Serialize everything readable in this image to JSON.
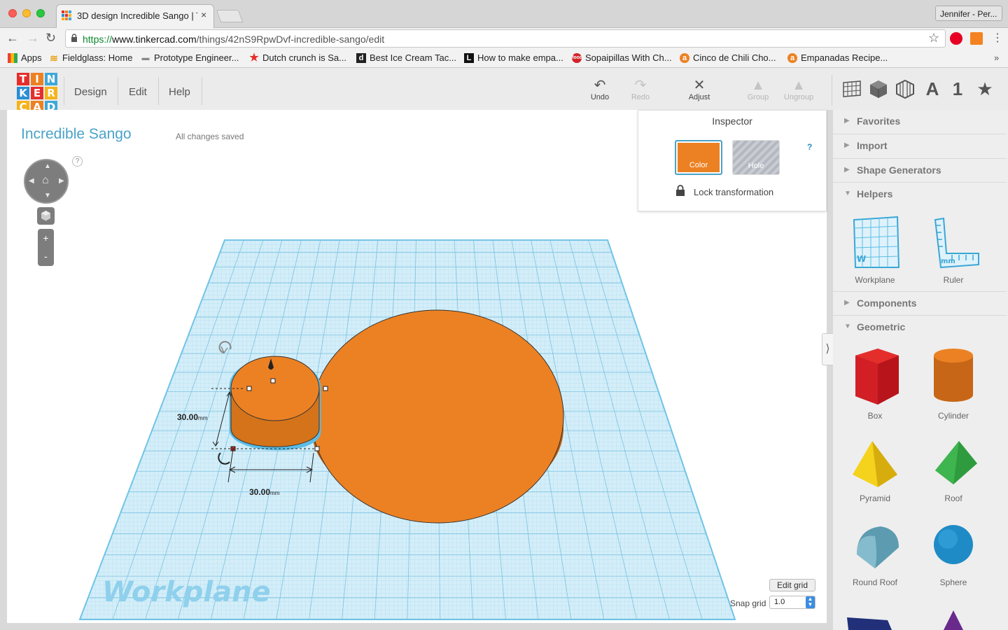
{
  "browser": {
    "tab_title": "3D design Incredible Sango | T",
    "tab_close": "×",
    "profile": "Jennifer - Per...",
    "url_scheme": "https://",
    "url_host": "www.tinkercad.com",
    "url_path": "/things/42nS9RpwDvf-incredible-sango/edit",
    "bookmarks": [
      {
        "label": "Apps",
        "icon": "apps-grid-icon"
      },
      {
        "label": "Fieldglass: Home",
        "icon": "fieldglass-icon"
      },
      {
        "label": "Prototype Engineer...",
        "icon": "dash-icon"
      },
      {
        "label": "Dutch crunch is Sa...",
        "icon": "red-star-icon"
      },
      {
        "label": "Best Ice Cream Tac...",
        "icon": "d-logo-icon"
      },
      {
        "label": "How to make empa...",
        "icon": "l-logo-icon"
      },
      {
        "label": "Sopaipillas With Ch...",
        "icon": "food-icon"
      },
      {
        "label": "Cinco de Chili Cho...",
        "icon": "orange-circle-icon"
      },
      {
        "label": "Empanadas Recipe...",
        "icon": "orange-circle-icon"
      }
    ],
    "bookmarks_more": "»"
  },
  "tinkercad": {
    "logo_letters": [
      "T",
      "I",
      "N",
      "K",
      "E",
      "R",
      "C",
      "A",
      "D"
    ],
    "logo_colors": [
      "#e42e2c",
      "#ec8123",
      "#3ea8d8",
      "#2a8ed4",
      "#e42e2c",
      "#f5b31b",
      "#f5b31b",
      "#ec8123",
      "#3ea8d8"
    ],
    "menu": [
      "Design",
      "Edit",
      "Help"
    ],
    "tools": {
      "undo": "Undo",
      "redo": "Redo",
      "adjust": "Adjust",
      "group": "Group",
      "ungroup": "Ungroup"
    },
    "library_tabs": [
      "grid-icon",
      "cube-icon",
      "striped-cube-icon",
      "A",
      "1",
      "★"
    ],
    "design_title": "Incredible Sango",
    "save_status": "All changes saved",
    "help_badge": "?",
    "inspector": {
      "title": "Inspector",
      "help": "?",
      "color_label": "Color",
      "hole_label": "Hole",
      "lock_label": "Lock transformation"
    },
    "dimensions": {
      "height": "30.00",
      "width": "30.00",
      "unit": "mm"
    },
    "workplane_label": "Workplane",
    "edit_grid": "Edit grid",
    "snap_grid_label": "Snap grid",
    "snap_grid_value": "1.0",
    "panel_toggle": "⟩",
    "sidebar_sections": {
      "favorites": "Favorites",
      "import": "Import",
      "shape_generators": "Shape Generators",
      "helpers": "Helpers",
      "components": "Components",
      "geometric": "Geometric"
    },
    "helpers": [
      "Workplane",
      "Ruler"
    ],
    "geometric": [
      "Box",
      "Cylinder",
      "Pyramid",
      "Roof",
      "Round Roof",
      "Sphere"
    ],
    "colors": {
      "accent": "#4aa3c8",
      "orange": "#ec8123",
      "workplane": "#bfe6f5",
      "grid_line": "#88c8e3"
    }
  }
}
